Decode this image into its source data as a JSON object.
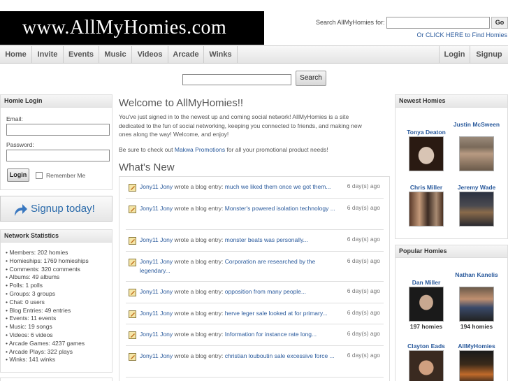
{
  "header": {
    "logo": "www.AllMyHomies.com",
    "search_label": "Search AllMyHomies for:",
    "go_label": "Go",
    "find_homies": "Or CLICK HERE to Find Homies"
  },
  "nav": {
    "left": [
      "Home",
      "Invite",
      "Events",
      "Music",
      "Videos",
      "Arcade",
      "Winks"
    ],
    "right": [
      "Login",
      "Signup"
    ]
  },
  "main_search": {
    "button": "Search"
  },
  "login": {
    "title": "Homie Login",
    "email_label": "Email:",
    "password_label": "Password:",
    "button": "Login",
    "remember": "Remember Me"
  },
  "signup": {
    "label": "Signup today!"
  },
  "stats": {
    "title": "Network Statistics",
    "items": [
      "• Members: 202 homies",
      "• Homieships: 1769 homieships",
      "• Comments: 320 comments",
      "• Albums: 49 albums",
      "• Polls: 1 polls",
      "• Groups: 3 groups",
      "• Chat: 0 users",
      "• Blog Entries: 49 entries",
      "• Events: 11 events",
      "• Music: 19 songs",
      "• Videos: 6 videos",
      "• Arcade Games: 4237 games",
      "• Arcade Plays: 322 plays",
      "• Winks: 141 winks"
    ]
  },
  "welcome": {
    "title": "Welcome to AllMyHomies!!",
    "text": "You've just signed in to the newest up and coming social network! AllMyHomies is a site dedicated to the fun of social networking, keeping you connected to friends, and making new ones along the way! Welcome, and enjoy!",
    "promo_prefix": "Be sure to check out ",
    "promo_link": "Makwa Promotions",
    "promo_suffix": " for all your promotional product needs!"
  },
  "whats_new": {
    "title": "What's New",
    "entries": [
      {
        "user": "Jony11 Jony",
        "action": " wrote a blog entry: ",
        "title": "much we liked them once we got them...",
        "time": "6 day(s) ago"
      },
      {
        "user": "Jony11 Jony",
        "action": " wrote a blog entry: ",
        "title": "Monster's powered isolation technology ...",
        "time": "6 day(s) ago"
      },
      {
        "user": "Jony11 Jony",
        "action": " wrote a blog entry: ",
        "title": "monster beats was personally...",
        "time": "6 day(s) ago"
      },
      {
        "user": "Jony11 Jony",
        "action": " wrote a blog entry: ",
        "title": "Corporation are researched by the legendary...",
        "time": "6 day(s) ago"
      },
      {
        "user": "Jony11 Jony",
        "action": " wrote a blog entry: ",
        "title": "opposition from many people...",
        "time": "6 day(s) ago"
      },
      {
        "user": "Jony11 Jony",
        "action": " wrote a blog entry: ",
        "title": "herve leger sale looked at for primary...",
        "time": "6 day(s) ago"
      },
      {
        "user": "Jony11 Jony",
        "action": " wrote a blog entry: ",
        "title": "Information for instance rate long...",
        "time": "6 day(s) ago"
      },
      {
        "user": "Jony11 Jony",
        "action": " wrote a blog entry: ",
        "title": "christian louboutin sale excessive force ...",
        "time": "6 day(s) ago"
      }
    ]
  },
  "newest_homies": {
    "title": "Newest Homies",
    "homies": [
      {
        "name": "Tonya Deaton"
      },
      {
        "name": "Justin McSween"
      },
      {
        "name": "Chris Miller"
      },
      {
        "name": "Jeremy Wade"
      }
    ]
  },
  "popular_homies": {
    "title": "Popular Homies",
    "homies": [
      {
        "name": "Dan Miller",
        "count": "197 homies"
      },
      {
        "name": "Nathan Kanelis",
        "count": "194 homies"
      },
      {
        "name": "Clayton Eads"
      },
      {
        "name": "AllMyHomies"
      }
    ]
  }
}
